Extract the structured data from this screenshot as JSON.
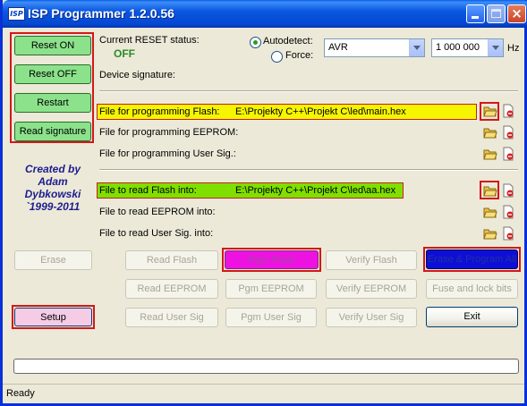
{
  "window": {
    "title": "ISP Programmer 1.2.0.56",
    "icon_text": "ISP"
  },
  "left_panel": {
    "reset_on": "Reset ON",
    "reset_off": "Reset OFF",
    "restart": "Restart",
    "read_signature": "Read signature",
    "author_lines": [
      "Created by",
      "Adam",
      "Dybkowski",
      "`1999-2011"
    ]
  },
  "reset": {
    "label": "Current RESET status:",
    "value": "OFF"
  },
  "detect": {
    "autodetect_label": "Autodetect:",
    "force_label": "Force:",
    "selected": "autodetect",
    "device": "AVR",
    "speed": "1 000 000",
    "unit": "Hz"
  },
  "signature": {
    "label": "Device signature:"
  },
  "files_program": [
    {
      "label": "File for programming Flash:",
      "path": "E:\\Projekty C++\\Projekt C\\led\\main.hex",
      "highlight": "yellow"
    },
    {
      "label": "File for programming EEPROM:",
      "path": ""
    },
    {
      "label": "File for programming User Sig.:",
      "path": ""
    }
  ],
  "files_read": [
    {
      "label": "File to read Flash into:",
      "path": "E:\\Projekty C++\\Projekt C\\led\\aa.hex",
      "highlight": "green"
    },
    {
      "label": "File to read EEPROM into:",
      "path": ""
    },
    {
      "label": "File to read User Sig. into:",
      "path": ""
    }
  ],
  "actions": {
    "erase": "Erase",
    "setup": "Setup",
    "read_flash": "Read Flash",
    "pgm_flash": "Pgm Flash",
    "verify_flash": "Verify Flash",
    "erase_program_all": "Erase & Program All",
    "read_eeprom": "Read EEPROM",
    "pgm_eeprom": "Pgm EEPROM",
    "verify_eeprom": "Verify EEPROM",
    "fuse_lock": "Fuse and lock bits",
    "read_user_sig": "Read User Sig",
    "pgm_user_sig": "Pgm User Sig",
    "verify_user_sig": "Verify User Sig",
    "exit": "Exit"
  },
  "progress": {
    "value": 0
  },
  "status": {
    "text": "Ready"
  },
  "colors": {
    "highlight_yellow": "#f5f500",
    "highlight_green": "#7fe000",
    "pgm_flash": "#ee12e2",
    "erase_program_all": "#0d0fd6",
    "reset_status": "#2a8a2a"
  }
}
